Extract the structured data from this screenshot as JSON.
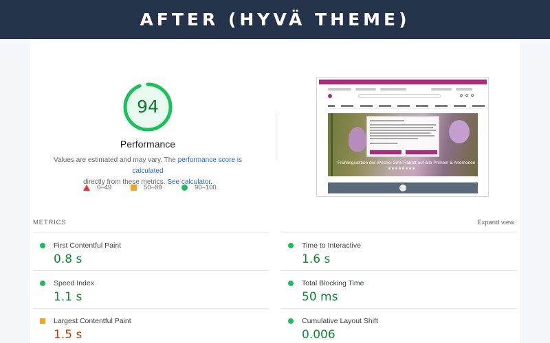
{
  "banner": {
    "title": "AFTER (HYVÄ THEME)"
  },
  "score": {
    "value": 94,
    "fraction": 0.94,
    "label": "Performance",
    "desc_part1": "Values are estimated and may vary. The ",
    "desc_link1": "performance score is calculated",
    "desc_part2": "directly from these metrics. ",
    "desc_link2": "See calculator.",
    "color": "#18c15a"
  },
  "legend": [
    {
      "range": "0–49",
      "color": "#e8342e",
      "shape": "triangle"
    },
    {
      "range": "50–89",
      "color": "#f4a623",
      "shape": "square"
    },
    {
      "range": "90–100",
      "color": "#18c15a",
      "shape": "circle"
    }
  ],
  "screenshot": {
    "hero_text": "Frühlingsaktion der Woche: 30% Rabatt auf alle Primeln & Anemonen"
  },
  "metrics": {
    "title": "METRICS",
    "expand_label": "Expand view",
    "items": [
      {
        "name": "First Contentful Paint",
        "value": "0.8 s",
        "status": "good"
      },
      {
        "name": "Time to Interactive",
        "value": "1.6 s",
        "status": "good"
      },
      {
        "name": "Speed Index",
        "value": "1.1 s",
        "status": "good"
      },
      {
        "name": "Total Blocking Time",
        "value": "50 ms",
        "status": "good"
      },
      {
        "name": "Largest Contentful Paint",
        "value": "1.5 s",
        "status": "average"
      },
      {
        "name": "Cumulative Layout Shift",
        "value": "0.006",
        "status": "good"
      }
    ]
  }
}
